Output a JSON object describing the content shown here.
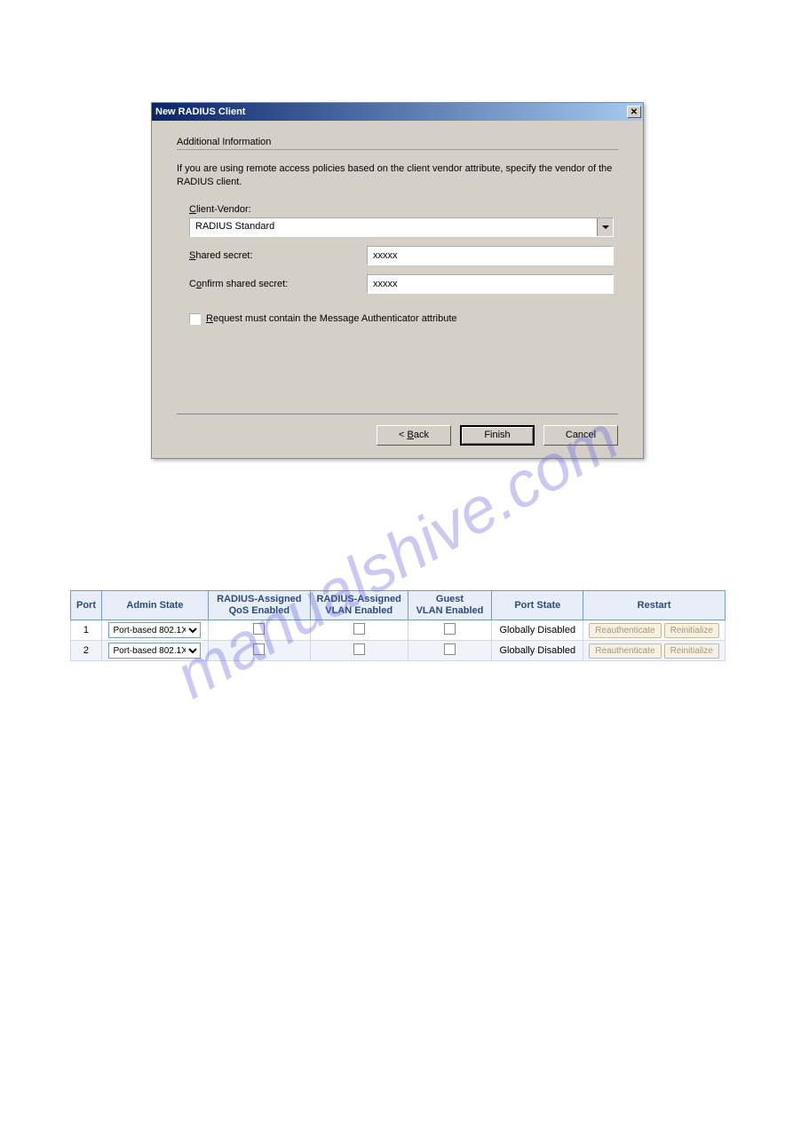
{
  "watermark": "manualshive.com",
  "dialog": {
    "title": "New RADIUS Client",
    "section_header": "Additional Information",
    "description": "If you are using remote access policies based on the client vendor attribute, specify the vendor of the RADIUS client.",
    "client_vendor_label": "Client-Vendor:",
    "client_vendor_value": "RADIUS Standard",
    "shared_secret_label": "Shared secret:",
    "shared_secret_value": "xxxxx",
    "confirm_secret_label": "Confirm shared secret:",
    "confirm_secret_value": "xxxxx",
    "checkbox_label": "Request must contain the Message Authenticator attribute",
    "back_button": "< Back",
    "finish_button": "Finish",
    "cancel_button": "Cancel"
  },
  "table": {
    "headers": {
      "port": "Port",
      "admin_state": "Admin State",
      "qos": "RADIUS-Assigned QoS Enabled",
      "vlan": "RADIUS-Assigned VLAN Enabled",
      "guest": "Guest VLAN Enabled",
      "port_state": "Port State",
      "restart": "Restart"
    },
    "admin_state_option": "Port-based 802.1X",
    "reauth_button": "Reauthenticate",
    "reinit_button": "Reinitialize",
    "rows": [
      {
        "port": "1",
        "port_state": "Globally Disabled"
      },
      {
        "port": "2",
        "port_state": "Globally Disabled"
      }
    ]
  }
}
